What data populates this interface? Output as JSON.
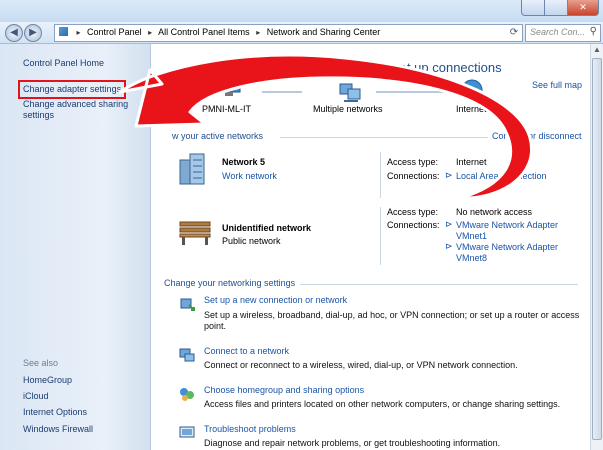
{
  "address": {
    "crumbs": [
      "Control Panel",
      "All Control Panel Items",
      "Network and Sharing Center"
    ],
    "search_placeholder": "Search Con..."
  },
  "sidebar": {
    "home": "Control Panel Home",
    "adapter": "Change adapter settings",
    "advanced": "Change advanced sharing settings",
    "see_also": "See also",
    "links": [
      "HomeGroup",
      "iCloud",
      "Internet Options",
      "Windows Firewall"
    ]
  },
  "main": {
    "title": "your basic network information and set up connections",
    "see_full_map": "See full map",
    "map": {
      "computer": "PMNI-ML-IT",
      "middle": "Multiple networks",
      "internet": "Internet"
    },
    "view_active": "w your active networks",
    "connect_disconnect": "Connect or disconnect",
    "networks": [
      {
        "name": "Network  5",
        "type": "Work network",
        "access_label": "Access type:",
        "access_value": "Internet",
        "connections_label": "Connections:",
        "connections": [
          "Local Area Connection"
        ]
      },
      {
        "name": "Unidentified network",
        "type": "Public network",
        "access_label": "Access type:",
        "access_value": "No network access",
        "connections_label": "Connections:",
        "connections": [
          "VMware Network Adapter",
          "VMnet1",
          "VMware Network Adapter",
          "VMnet8"
        ]
      }
    ],
    "change_title": "Change your networking settings",
    "tasks": [
      {
        "link": "Set up a new connection or network",
        "desc": "Set up a wireless, broadband, dial-up, ad hoc, or VPN connection; or set up a router or access point."
      },
      {
        "link": "Connect to a network",
        "desc": "Connect or reconnect to a wireless, wired, dial-up, or VPN network connection."
      },
      {
        "link": "Choose homegroup and sharing options",
        "desc": "Access files and printers located on other network computers, or change sharing settings."
      },
      {
        "link": "Troubleshoot problems",
        "desc": "Diagnose and repair network problems, or get troubleshooting information."
      }
    ]
  },
  "colors": {
    "link": "#1a54a6",
    "heading": "#1f4f8e",
    "arrow": "#e0141a",
    "highlight_box": "#e0141a"
  }
}
